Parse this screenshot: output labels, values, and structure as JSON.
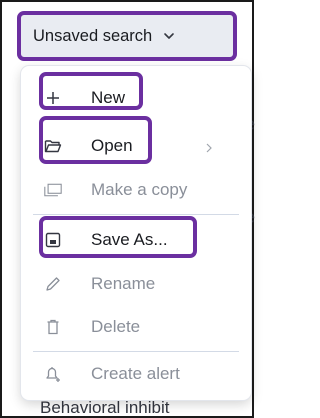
{
  "trigger": {
    "label": "Unsaved search"
  },
  "menu": {
    "items": [
      {
        "label": "New",
        "icon": "plus-icon",
        "enabled": true,
        "highlighted": true
      },
      {
        "label": "Open",
        "icon": "folder-open-icon",
        "enabled": true,
        "highlighted": true,
        "has_submenu": true
      },
      {
        "label": "Make a copy",
        "icon": "copy-icon",
        "enabled": false
      },
      {
        "label": "Save As...",
        "icon": "save-icon",
        "enabled": true,
        "highlighted": true
      },
      {
        "label": "Rename",
        "icon": "pencil-icon",
        "enabled": false
      },
      {
        "label": "Delete",
        "icon": "trash-icon",
        "enabled": false
      },
      {
        "label": "Create alert",
        "icon": "bell-plus-icon",
        "enabled": false
      }
    ]
  },
  "background": {
    "peek_char_1": "e",
    "peek_char_2": "e",
    "bottom_text": "Behavioral inhibit"
  },
  "colors": {
    "highlight": "#6b2fa0",
    "trigger_bg": "#e9ecf2",
    "disabled_text": "#8a8f99",
    "enabled_text": "#1a1c21"
  }
}
